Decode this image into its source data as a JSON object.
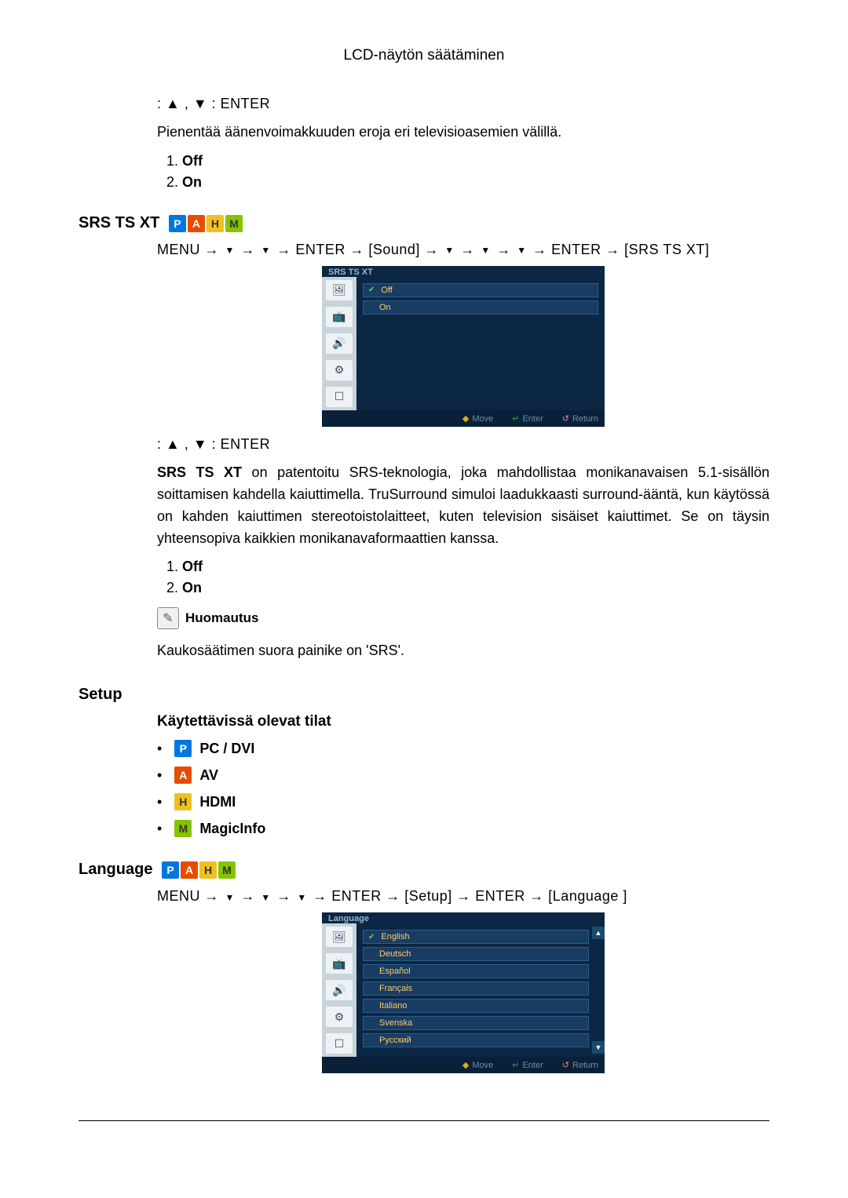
{
  "header": {
    "title": "LCD-näytön säätäminen"
  },
  "nav_simple": ": ▲ , ▼ : ENTER",
  "section_autovol": {
    "desc": "Pienentää äänenvoimakkuuden eroja eri televisioasemien välillä.",
    "options": [
      "Off",
      "On"
    ]
  },
  "section_srs": {
    "title": "SRS TS XT",
    "breadcrumb_parts": {
      "menu": "MENU →",
      "enter_sound": "→ ENTER → [Sound] →",
      "enter_srs": "→ ENTER → [SRS TS XT]"
    },
    "osd": {
      "title": "SRS TS XT",
      "options": [
        "Off",
        "On"
      ],
      "footer": {
        "move": "Move",
        "enter": "Enter",
        "return": "Return"
      }
    },
    "desc_prefix": "SRS TS XT",
    "desc_rest": " on patentoitu SRS-teknologia, joka mahdollistaa monikanavaisen 5.1-sisällön soittamisen kahdella kaiuttimella. TruSurround simuloi laadukkaasti surround-ääntä, kun käytössä on kahden kaiuttimen stereotoistolaitteet, kuten television sisäiset kaiuttimet. Se on täysin yhteensopiva kaikkien monikanavaformaattien kanssa.",
    "options": [
      "Off",
      "On"
    ],
    "note_label": "Huomautus",
    "note_text": "Kaukosäätimen suora painike on 'SRS'."
  },
  "section_setup": {
    "title": "Setup",
    "subtitle": "Käytettävissä olevat tilat",
    "modes": [
      {
        "icon": "P",
        "label": "PC / DVI"
      },
      {
        "icon": "A",
        "label": "AV"
      },
      {
        "icon": "H",
        "label": "HDMI"
      },
      {
        "icon": "M",
        "label": "MagicInfo"
      }
    ]
  },
  "section_language": {
    "title": "Language",
    "breadcrumb_parts": {
      "menu": "MENU →",
      "enter_setup": "→ ENTER → [Setup] → ENTER → [Language ]"
    },
    "osd": {
      "title": "Language",
      "options": [
        "English",
        "Deutsch",
        "Español",
        "Français",
        "Italiano",
        "Svenska",
        "Русский"
      ],
      "footer": {
        "move": "Move",
        "enter": "Enter",
        "return": "Return"
      }
    }
  },
  "icons": {
    "P": "P",
    "A": "A",
    "H": "H",
    "M": "M"
  }
}
